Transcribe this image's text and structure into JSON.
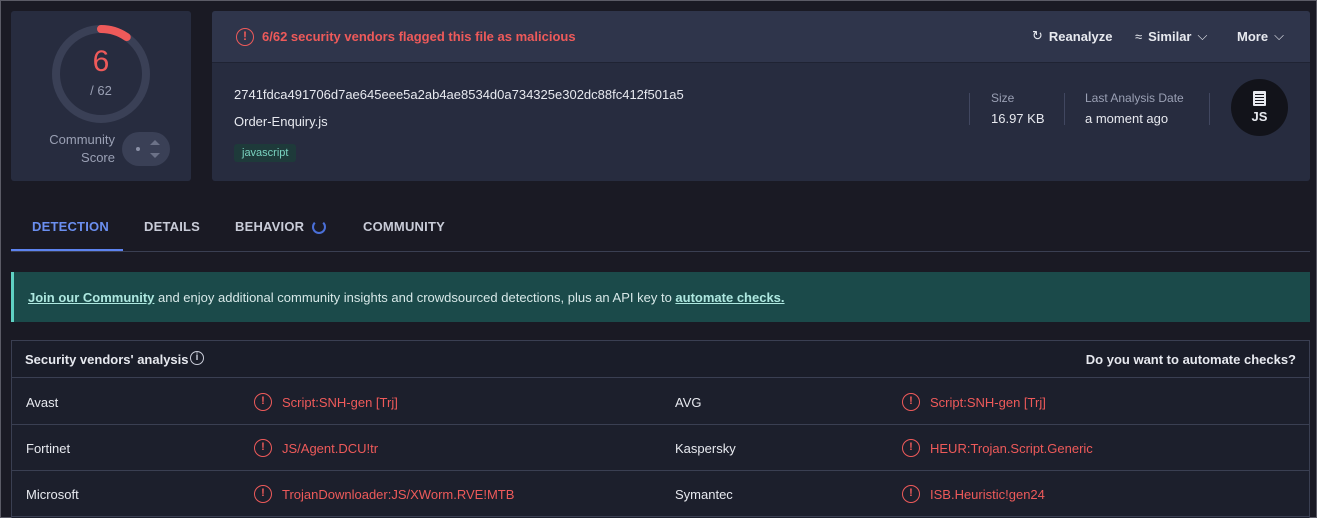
{
  "score": {
    "detections": "6",
    "total": "/ 62",
    "community_label_1": "Community",
    "community_label_2": "Score",
    "ratio": 0.0968
  },
  "alert": {
    "text": "6/62 security vendors flagged this file as malicious",
    "icon": "alert-circle-icon"
  },
  "actions": {
    "reanalyze": "Reanalyze",
    "similar": "Similar",
    "more": "More"
  },
  "file": {
    "hash": "2741fdca491706d7ae645eee5a2ab4ae8534d0a734325e302dc88fc412f501a5",
    "name": "Order-Enquiry.js",
    "tag": "javascript",
    "size_label": "Size",
    "size_value": "16.97 KB",
    "date_label": "Last Analysis Date",
    "date_value": "a moment ago",
    "type_label": "JS"
  },
  "tabs": [
    {
      "label": "DETECTION",
      "active": true
    },
    {
      "label": "DETAILS",
      "active": false
    },
    {
      "label": "BEHAVIOR",
      "active": false
    },
    {
      "label": "COMMUNITY",
      "active": false
    }
  ],
  "banner": {
    "link1": "Join our Community",
    "middle": " and enjoy additional community insights and crowdsourced detections, plus an API key to ",
    "link2": "automate checks."
  },
  "analysis": {
    "title": "Security vendors' analysis",
    "right": "Do you want to automate checks?",
    "rows": [
      {
        "v1": "Avast",
        "r1": "Script:SNH-gen [Trj]",
        "v2": "AVG",
        "r2": "Script:SNH-gen [Trj]"
      },
      {
        "v1": "Fortinet",
        "r1": "JS/Agent.DCU!tr",
        "v2": "Kaspersky",
        "r2": "HEUR:Trojan.Script.Generic"
      },
      {
        "v1": "Microsoft",
        "r1": "TrojanDownloader:JS/XWorm.RVE!MTB",
        "v2": "Symantec",
        "r2": "ISB.Heuristic!gen24"
      }
    ]
  },
  "colors": {
    "malicious": "#ee5a5a",
    "accent": "#5d83f0",
    "banner": "#1b4a4a"
  }
}
